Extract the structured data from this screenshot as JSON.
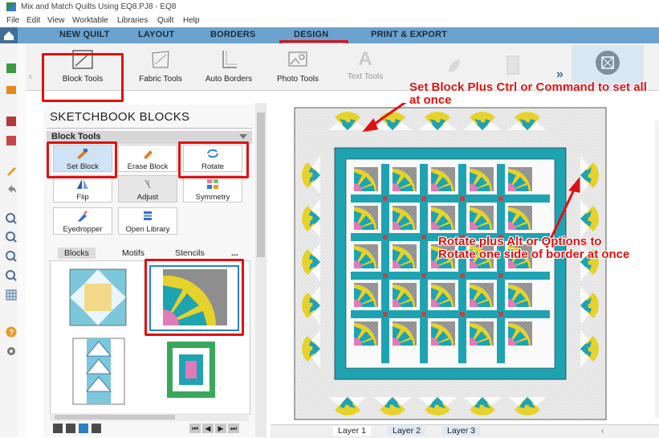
{
  "window": {
    "title": "Mix and Match Quilts Using EQ8.PJ8 - EQ8"
  },
  "menu": [
    "File",
    "Edit",
    "View",
    "Worktable",
    "Libraries",
    "Quilt",
    "Help"
  ],
  "ribbon_tabs": [
    "NEW QUILT",
    "LAYOUT",
    "BORDERS",
    "DESIGN",
    "PRINT & EXPORT"
  ],
  "active_tab": "DESIGN",
  "tools": [
    "Block Tools",
    "Fabric Tools",
    "Auto Borders",
    "Photo Tools",
    "Text Tools"
  ],
  "panel": {
    "title": "SKETCHBOOK BLOCKS",
    "section": "Block Tools",
    "buttons": [
      "Set Block",
      "Erase Block",
      "Rotate",
      "Flip",
      "Adjust",
      "Symmetry",
      "Eyedropper",
      "Open Library"
    ],
    "subtabs": [
      "Blocks",
      "Motifs",
      "Stencils",
      "..."
    ]
  },
  "layers": [
    "Layer 1",
    "Layer 2",
    "Layer 3"
  ],
  "annotations": {
    "set_block": "Set Block Plus Ctrl or Command to set all at once",
    "rotate": "Rotate plus Alt or Options to Rotate one side of border at once"
  },
  "colors": {
    "accent_red": "#e01010",
    "ribbon_blue": "#6aa3cf",
    "teal": "#1ea3b3",
    "yellow": "#e6d22a",
    "grey_fabric": "#8e8e8e",
    "border_light": "#e7e7e7"
  }
}
